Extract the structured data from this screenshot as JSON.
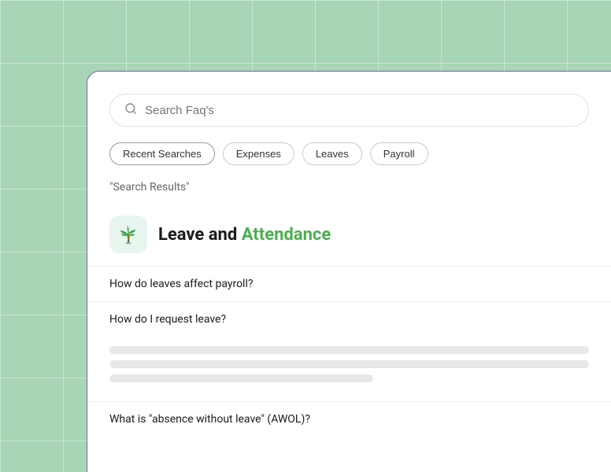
{
  "background": {
    "color": "#a8d5b5",
    "grid_color": "rgba(255,255,255,0.4)"
  },
  "card": {
    "border_color": "#7c5cbf"
  },
  "search": {
    "placeholder": "Search Faq's",
    "icon": "🔍"
  },
  "chips": [
    {
      "label": "Recent Searches",
      "active": true
    },
    {
      "label": "Expenses",
      "active": false
    },
    {
      "label": "Leaves",
      "active": false
    },
    {
      "label": "Payroll",
      "active": false
    }
  ],
  "results_label": "\"Search Results\"",
  "category": {
    "icon": "🌴",
    "title_plain": "Leave and ",
    "title_highlight": "Attendance"
  },
  "faq_items": [
    {
      "question": "How do leaves affect payroll?"
    },
    {
      "question": "How do I request leave?"
    },
    {
      "question": "What is \"absence without leave\" (AWOL)?"
    }
  ],
  "skeleton": {
    "lines": [
      "full",
      "full",
      "medium"
    ]
  }
}
